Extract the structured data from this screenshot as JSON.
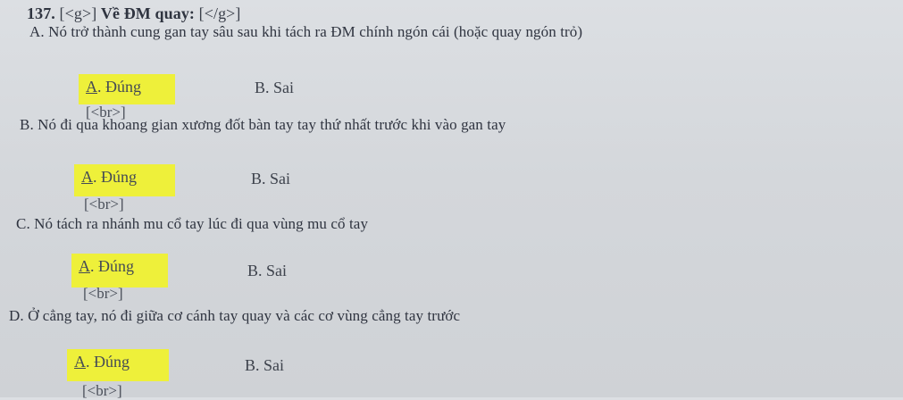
{
  "question": {
    "number": "137.",
    "open_tag": "[<g>]",
    "title": "Về ĐM quay:",
    "close_tag": "[</g>]"
  },
  "statements": [
    {
      "text": "A. Nó trở thành cung gan tay sâu sau khi tách ra ĐM chính ngón cái (hoặc quay ngón trỏ)",
      "true_option": "A. Đúng",
      "true_letter": "A",
      "true_rest": ". Đúng",
      "false_option": "B. Sai",
      "separator": "[<br>]"
    },
    {
      "text": "B. Nó đi qua khoang gian xương đốt bàn tay tay thứ nhất trước khi vào gan tay",
      "true_option": "A. Đúng",
      "true_letter": "A",
      "true_rest": ". Đúng",
      "false_option": "B. Sai",
      "separator": "[<br>]"
    },
    {
      "text": "C. Nó tách ra nhánh mu cổ tay lúc đi qua vùng mu cổ tay",
      "true_option": "A. Đúng",
      "true_letter": "A",
      "true_rest": ". Đúng",
      "false_option": "B. Sai",
      "separator": "[<br>]"
    },
    {
      "text": "D. Ở cẳng tay, nó đi giữa cơ cánh tay quay và các cơ vùng cẳng tay trước",
      "true_option": "A. Đúng",
      "true_letter": "A",
      "true_rest": ". Đúng",
      "false_option": "B. Sai",
      "separator": "[<br>]"
    }
  ],
  "colors": {
    "highlight": "#eef03a",
    "paper": "#d6d9dd",
    "ink": "#2f3440"
  }
}
